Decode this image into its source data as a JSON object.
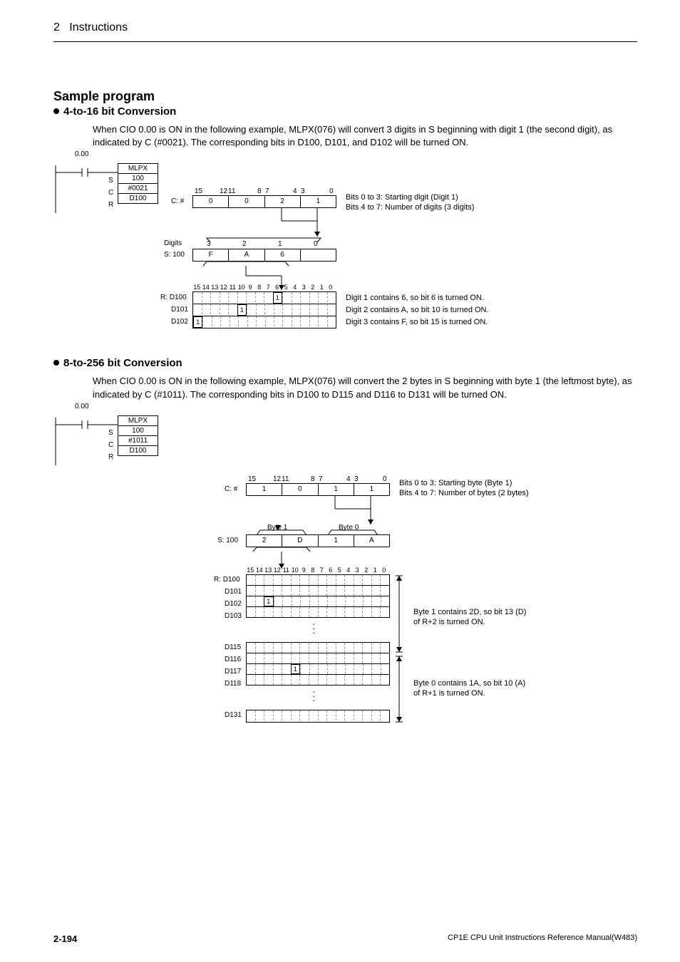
{
  "header": {
    "chapter_num": "2",
    "chapter_title": "Instructions"
  },
  "sample_program": {
    "title": "Sample program",
    "sec1": {
      "title": "4-to-16 bit Conversion",
      "para": "When CIO 0.00 is ON in the following example, MLPX(076) will convert 3 digits in S beginning with digit 1 (the second digit), as indicated by C (#0021). The corresponding bits in D100, D101, and D102 will be turned ON.",
      "ladder": {
        "addr": "0.00",
        "inst": "MLPX",
        "s_label": "S",
        "s_val": "100",
        "c_label": "C",
        "c_val": "#0021",
        "r_label": "R",
        "r_val": "D100"
      },
      "diagram": {
        "c_row_label": "C: #",
        "c_bits": {
          "b15": "15",
          "b12": "12",
          "b11": "11",
          "b8": "8",
          "b7": "7",
          "b4": "4",
          "b3": "3",
          "b0": "0"
        },
        "c_cells": [
          "0",
          "0",
          "2",
          "1"
        ],
        "c_note1": "Bits 0 to 3: Starting digit (Digit 1)",
        "c_note2": "Bits 4 to 7: Number of digits (3 digits)",
        "digits_label": "Digits",
        "digits_top": [
          "3",
          "2",
          "1",
          "0"
        ],
        "s_row_label": "S: 100",
        "s_cells": [
          "F",
          "A",
          "6",
          ""
        ],
        "bit_labels": [
          "15",
          "14",
          "13",
          "12",
          "11",
          "10",
          "9",
          "8",
          "7",
          "6",
          "5",
          "4",
          "3",
          "2",
          "1",
          "0"
        ],
        "r_label": "R: D100",
        "d101_label": "D101",
        "d102_label": "D102",
        "one": "1",
        "note1": "Digit 1 contains 6, so bit 6 is turned ON.",
        "note2": "Digit 2 contains A, so bit 10 is turned ON.",
        "note3": "Digit 3 contains F, so bit 15 is turned ON."
      }
    },
    "sec2": {
      "title": "8-to-256 bit Conversion",
      "para": "When CIO 0.00 is ON in the following example, MLPX(076) will convert the 2 bytes in S beginning with byte 1 (the leftmost byte), as indicated by C (#1011). The corresponding bits in D100 to D115 and D116 to D131 will be turned ON.",
      "ladder": {
        "addr": "0.00",
        "inst": "MLPX",
        "s_label": "S",
        "s_val": "100",
        "c_label": "C",
        "c_val": "#1011",
        "r_label": "R",
        "r_val": "D100"
      },
      "diagram": {
        "c_row_label": "C: #",
        "c_bits": {
          "b15": "15",
          "b12": "12",
          "b11": "11",
          "b8": "8",
          "b7": "7",
          "b4": "4",
          "b3": "3",
          "b0": "0"
        },
        "c_cells": [
          "1",
          "0",
          "1",
          "1"
        ],
        "c_note1": "Bits 0 to 3: Starting byte (Byte 1)",
        "c_note2": "Bits 4 to 7: Number of bytes (2 bytes)",
        "byte1": "Byte 1",
        "byte0": "Byte 0",
        "s_row_label": "S: 100",
        "s_cells": [
          "2",
          "D",
          "1",
          "A"
        ],
        "bit_labels": [
          "15",
          "14",
          "13",
          "12",
          "11",
          "10",
          "9",
          "8",
          "7",
          "6",
          "5",
          "4",
          "3",
          "2",
          "1",
          "0"
        ],
        "r_label": "R: D100",
        "d101": "D101",
        "d102": "D102",
        "d103": "D103",
        "d115": "D115",
        "d116": "D116",
        "d117": "D117",
        "d118": "D118",
        "d131": "D131",
        "one": "1",
        "note1a": "Byte 1 contains 2D, so bit 13 (D)",
        "note1b": "of R+2 is turned ON.",
        "note2a": "Byte 0 contains 1A, so bit 10 (A)",
        "note2b": "of R+1 is turned ON."
      }
    }
  },
  "footer": {
    "page": "2-194",
    "manual": "CP1E CPU Unit Instructions Reference Manual(W483)"
  }
}
